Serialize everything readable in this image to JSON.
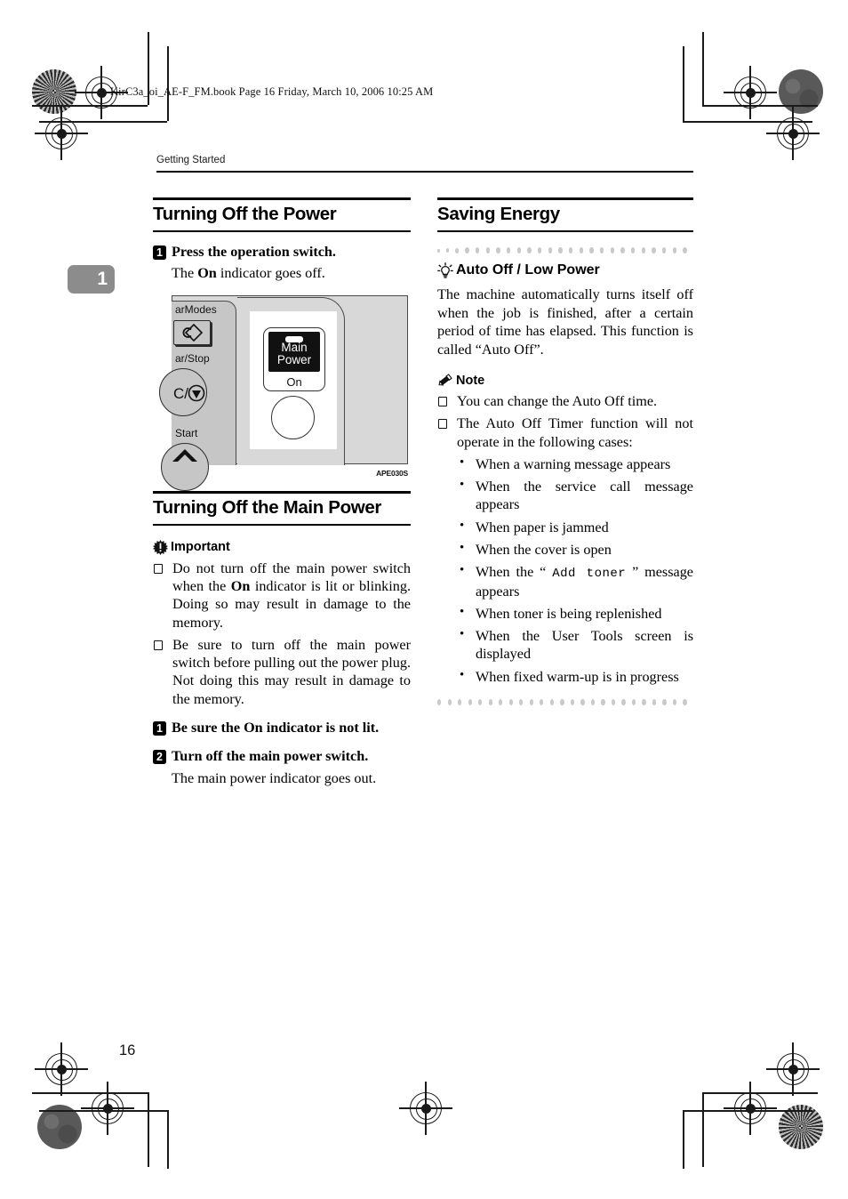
{
  "file_header": "KirC3a_oi_AE-F_FM.book  Page 16  Friday, March 10, 2006  10:25 AM",
  "running_head": "Getting Started",
  "chapter_tab": "1",
  "page_number": "16",
  "left_column": {
    "section1": {
      "heading": "Turning Off the Power",
      "step1_num": "1",
      "step1_title": "Press the operation switch.",
      "step1_body": "The On indicator goes off.",
      "step1_body_pre": "The ",
      "step1_body_bold": "On",
      "step1_body_post": " indicator goes off.",
      "figure": {
        "label_clear_modes": "arModes",
        "label_clear_stop": "ar/Stop",
        "label_clear_stop_key": "C/",
        "label_start": "Start",
        "indicator_line1": "Main",
        "indicator_line2": "Power",
        "indicator_on": "On",
        "caption": "APE030S"
      }
    },
    "section2": {
      "heading": "Turning Off the Main Power",
      "important_label": "Important",
      "important_items": [
        {
          "pre": "Do not turn off the main power switch when the ",
          "bold": "On",
          "post": " indicator is lit or blinking. Doing so may result in damage to the memory."
        },
        {
          "pre": "Be sure to turn off the main power switch before pulling out the power plug. Not doing this may result in damage to the memory.",
          "bold": "",
          "post": ""
        }
      ],
      "step1_num": "1",
      "step1_title": "Be sure the On indicator is not lit.",
      "step2_num": "2",
      "step2_title": "Turn off the main power switch.",
      "step2_body": "The main power indicator goes out."
    }
  },
  "right_column": {
    "heading": "Saving Energy",
    "subsection_title": "Auto Off / Low Power",
    "paragraph": "The machine automatically turns itself off when the job is finished, after a certain period of time has elapsed. This function is called “Auto Off”.",
    "note_label": "Note",
    "note_items": [
      "You can change the Auto Off time.",
      "The Auto Off Timer function will not operate in the following cases:"
    ],
    "bullets": [
      {
        "pre": "When a warning message appears",
        "mono": "",
        "post": ""
      },
      {
        "pre": "When the service call message appears",
        "mono": "",
        "post": ""
      },
      {
        "pre": "When paper is jammed",
        "mono": "",
        "post": ""
      },
      {
        "pre": "When the cover is open",
        "mono": "",
        "post": ""
      },
      {
        "pre": "When the “ ",
        "mono": "Add toner",
        "post": " ” message appears"
      },
      {
        "pre": "When toner is being replenished",
        "mono": "",
        "post": ""
      },
      {
        "pre": "When the User Tools screen is displayed",
        "mono": "",
        "post": ""
      },
      {
        "pre": "When fixed warm-up is in progress",
        "mono": "",
        "post": ""
      }
    ]
  },
  "icons": {
    "important": "starburst-exclamation-icon",
    "note": "pencil-icon",
    "tip": "lightbulb-icon"
  }
}
